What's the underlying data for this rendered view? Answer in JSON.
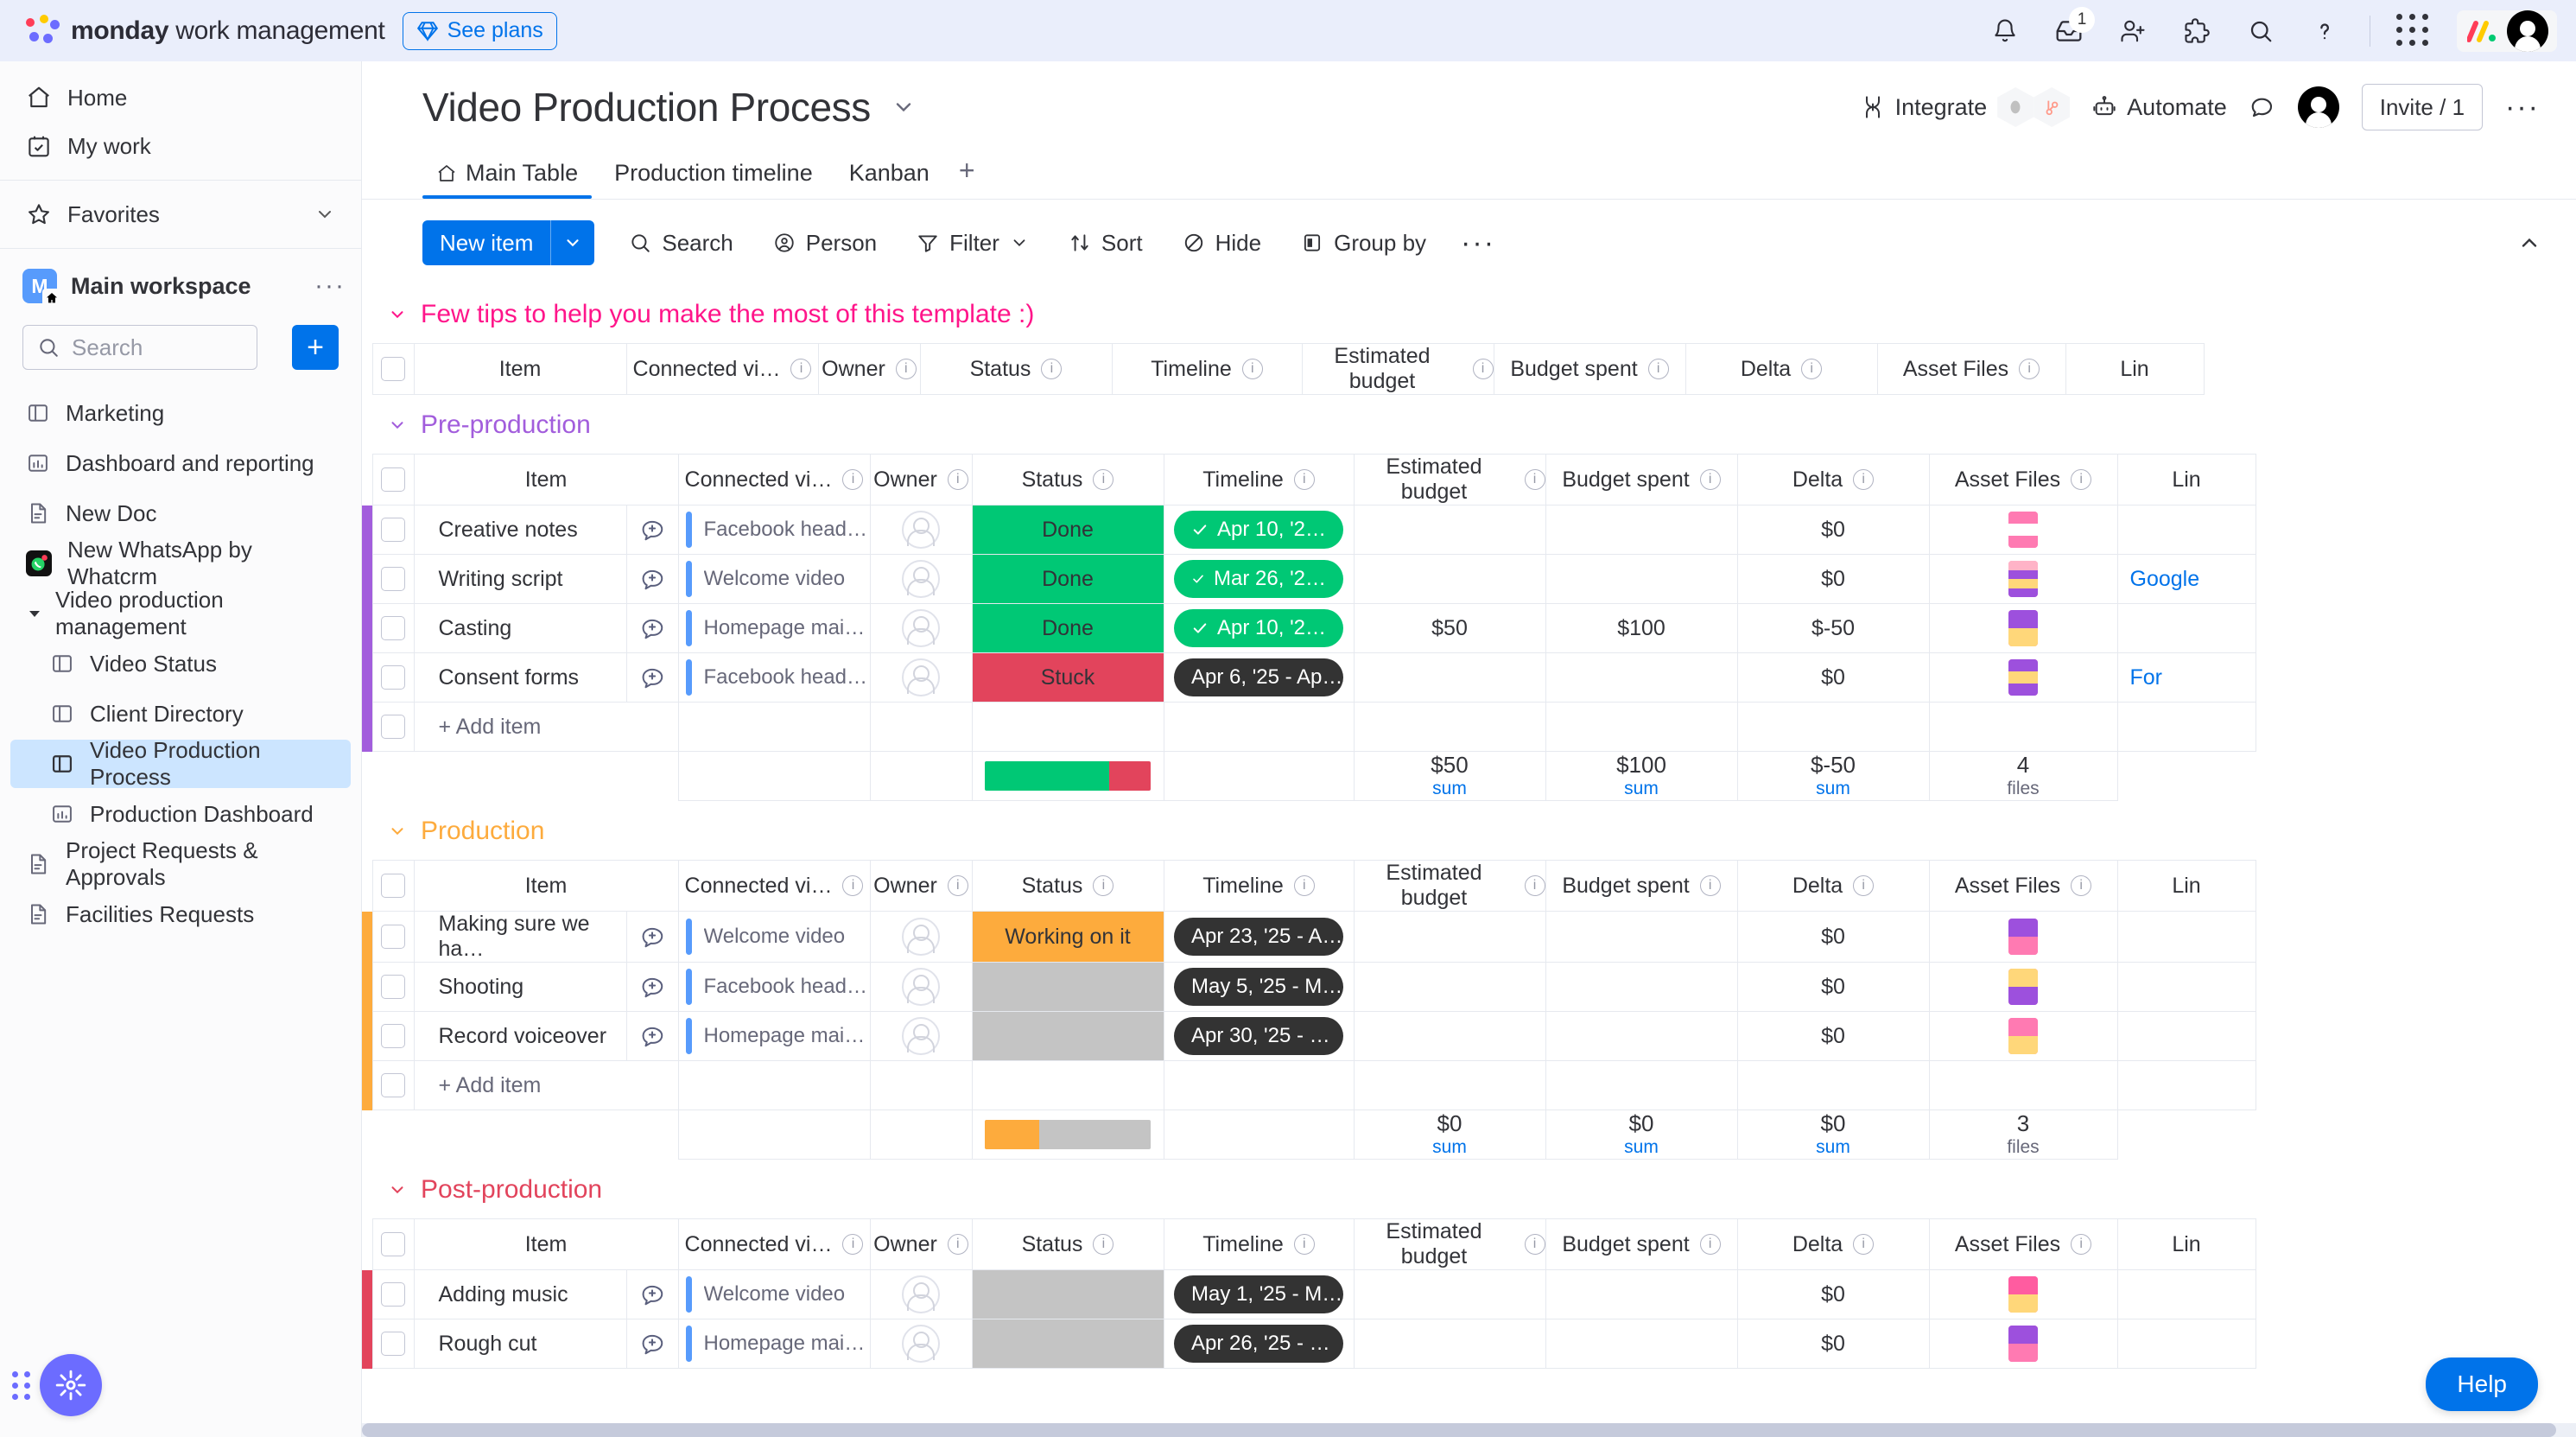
{
  "topbar": {
    "brand_bold": "monday",
    "brand_rest": " work management",
    "see_plans": "See plans",
    "icons": [
      {
        "name": "notifications-icon",
        "glyph": "bell"
      },
      {
        "name": "inbox-icon",
        "glyph": "inbox",
        "badge": "1"
      },
      {
        "name": "invite-members-icon",
        "glyph": "person-plus"
      },
      {
        "name": "apps-marketplace-icon",
        "glyph": "puzzle"
      },
      {
        "name": "search-icon",
        "glyph": "search"
      },
      {
        "name": "help-icon",
        "glyph": "question"
      }
    ],
    "product_switcher": "apps-grid-icon",
    "avatar": "user-avatar"
  },
  "sidebar": {
    "nav": [
      {
        "label": "Home",
        "icon": "home-icon"
      },
      {
        "label": "My work",
        "icon": "my-work-icon"
      },
      {
        "label": "Favorites",
        "icon": "star-icon",
        "chevron": true
      }
    ],
    "workspace": {
      "initial": "M",
      "name": "Main workspace",
      "more": "···"
    },
    "search_placeholder": "Search",
    "add_label": "+",
    "boards": [
      {
        "label": "Marketing",
        "icon": "board-icon",
        "nested": false,
        "active": false
      },
      {
        "label": "Dashboard and reporting",
        "icon": "dashboard-icon",
        "nested": false,
        "active": false
      },
      {
        "label": "New Doc",
        "icon": "doc-icon",
        "nested": false,
        "active": false
      },
      {
        "label": "New WhatsApp by Whatcrm",
        "icon": "whatsapp-icon",
        "nested": false,
        "active": false
      }
    ],
    "folder": {
      "label": "Video production management",
      "icon": "chevron-down-icon",
      "children": [
        {
          "label": "Video Status",
          "icon": "board-icon",
          "active": false
        },
        {
          "label": "Client Directory",
          "icon": "board-icon",
          "active": false
        },
        {
          "label": "Video Production Process",
          "icon": "board-icon",
          "active": true
        },
        {
          "label": "Production Dashboard",
          "icon": "dashboard-icon",
          "active": false
        }
      ]
    },
    "boards_after": [
      {
        "label": "Project Requests & Approvals",
        "icon": "doc-icon"
      },
      {
        "label": "Facilities Requests",
        "icon": "doc-icon"
      }
    ],
    "ai_fab": "ai-assistant-icon"
  },
  "board": {
    "title": "Video Production Process",
    "title_chevron": "chevron-down-icon",
    "header_actions": {
      "integrate": "Integrate",
      "automate": "Automate",
      "invite": "Invite / 1",
      "more": "···"
    },
    "tabs": [
      {
        "label": "Main Table",
        "icon": "home-icon",
        "active": true
      },
      {
        "label": "Production timeline",
        "active": false
      },
      {
        "label": "Kanban",
        "active": false
      }
    ],
    "tab_add": "+",
    "toolbar": {
      "new_item": "New item",
      "new_item_chevron": "chevron-down-icon",
      "buttons": [
        {
          "label": "Search",
          "icon": "search-icon"
        },
        {
          "label": "Person",
          "icon": "person-icon"
        },
        {
          "label": "Filter",
          "icon": "filter-icon",
          "chevron": true
        },
        {
          "label": "Sort",
          "icon": "sort-icon"
        },
        {
          "label": "Hide",
          "icon": "hide-icon"
        },
        {
          "label": "Group by",
          "icon": "group-by-icon"
        }
      ],
      "overflow": "···",
      "collapse": "chevron-up-icon"
    }
  },
  "columns": [
    {
      "label": "Item",
      "info": false
    },
    {
      "label": "Connected vi…",
      "info": true
    },
    {
      "label": "Owner",
      "info": true
    },
    {
      "label": "Status",
      "info": true
    },
    {
      "label": "Timeline",
      "info": true
    },
    {
      "label": "Estimated budget",
      "info": true
    },
    {
      "label": "Budget spent",
      "info": true
    },
    {
      "label": "Delta",
      "info": true
    },
    {
      "label": "Asset Files",
      "info": true
    },
    {
      "label": "Lin",
      "info": false
    }
  ],
  "groups": [
    {
      "title": "Few tips to help you make the most of this template :)",
      "color": "#ff158a",
      "rows": [],
      "has_add_item": false,
      "has_summary": false
    },
    {
      "title": "Pre-production",
      "color": "#a25ddc",
      "rows": [
        {
          "item": "Creative notes",
          "connected": "Facebook head…",
          "status": "Done",
          "status_color": "#00c875",
          "timeline": "Apr 10, '2…",
          "timeline_style": "green-check",
          "estimated": "",
          "spent": "",
          "delta": "$0",
          "file_colors": [
            "#ff7ab2",
            "#ffffff",
            "#ff7ab2"
          ],
          "link": ""
        },
        {
          "item": "Writing script",
          "connected": "Welcome video",
          "status": "Done",
          "status_color": "#00c875",
          "timeline": "Mar 26, '2…",
          "timeline_style": "green-check",
          "estimated": "",
          "spent": "",
          "delta": "$0",
          "file_colors": [
            "#ffb3c7",
            "#9d50dd",
            "#ffd77a",
            "#9d50dd"
          ],
          "link": "Google"
        },
        {
          "item": "Casting",
          "connected": "Homepage mai…",
          "status": "Done",
          "status_color": "#00c875",
          "timeline": "Apr 10, '2…",
          "timeline_style": "green-check",
          "estimated": "$50",
          "spent": "$100",
          "delta": "$-50",
          "file_colors": [
            "#9d50dd",
            "#ffd77a"
          ],
          "link": ""
        },
        {
          "item": "Consent forms",
          "connected": "Facebook head…",
          "status": "Stuck",
          "status_color": "#e2445c",
          "timeline": "Apr 6, '25 - Ap…",
          "timeline_style": "dark",
          "estimated": "",
          "spent": "",
          "delta": "$0",
          "file_colors": [
            "#9d50dd",
            "#ffd77a",
            "#9d50dd"
          ],
          "link": "For"
        }
      ],
      "add_item": "+ Add item",
      "summary": {
        "status_bar": [
          {
            "color": "#00c875",
            "pct": 75
          },
          {
            "color": "#e2445c",
            "pct": 25
          }
        ],
        "estimated": "$50",
        "estimated_sub": "sum",
        "spent": "$100",
        "spent_sub": "sum",
        "delta": "$-50",
        "delta_sub": "sum",
        "files": "4",
        "files_sub": "files"
      }
    },
    {
      "title": "Production",
      "color": "#fdab3d",
      "rows": [
        {
          "item": "Making sure we ha…",
          "connected": "Welcome video",
          "status": "Working on it",
          "status_color": "#fdab3d",
          "timeline": "Apr 23, '25 - A…",
          "timeline_style": "dark",
          "estimated": "",
          "spent": "",
          "delta": "$0",
          "file_colors": [
            "#9d50dd",
            "#ff7ab2"
          ],
          "link": ""
        },
        {
          "item": "Shooting",
          "connected": "Facebook head…",
          "status": "",
          "status_color": "#c4c4c4",
          "timeline": "May 5, '25 - M…",
          "timeline_style": "dark",
          "estimated": "",
          "spent": "",
          "delta": "$0",
          "file_colors": [
            "#ffd77a",
            "#9d50dd"
          ],
          "link": ""
        },
        {
          "item": "Record voiceover",
          "connected": "Homepage mai…",
          "status": "",
          "status_color": "#c4c4c4",
          "timeline": "Apr 30, '25 - …",
          "timeline_style": "dark",
          "estimated": "",
          "spent": "",
          "delta": "$0",
          "file_colors": [
            "#ff7ab2",
            "#ffd77a"
          ],
          "link": ""
        }
      ],
      "add_item": "+ Add item",
      "summary": {
        "status_bar": [
          {
            "color": "#fdab3d",
            "pct": 33
          },
          {
            "color": "#c4c4c4",
            "pct": 67
          }
        ],
        "estimated": "$0",
        "estimated_sub": "sum",
        "spent": "$0",
        "spent_sub": "sum",
        "delta": "$0",
        "delta_sub": "sum",
        "files": "3",
        "files_sub": "files"
      }
    },
    {
      "title": "Post-production",
      "color": "#e2445c",
      "rows": [
        {
          "item": "Adding music",
          "connected": "Welcome video",
          "status": "",
          "status_color": "#c4c4c4",
          "timeline": "May 1, '25 - M…",
          "timeline_style": "dark",
          "estimated": "",
          "spent": "",
          "delta": "$0",
          "file_colors": [
            "#ff5ca0",
            "#ffd77a"
          ],
          "link": ""
        },
        {
          "item": "Rough cut",
          "connected": "Homepage mai…",
          "status": "",
          "status_color": "#c4c4c4",
          "timeline": "Apr 26, '25 - …",
          "timeline_style": "dark",
          "estimated": "",
          "spent": "",
          "delta": "$0",
          "file_colors": [
            "#9d50dd",
            "#ff7ab2"
          ],
          "link": ""
        }
      ],
      "add_item": "",
      "summary": null
    }
  ],
  "help_button": "Help"
}
